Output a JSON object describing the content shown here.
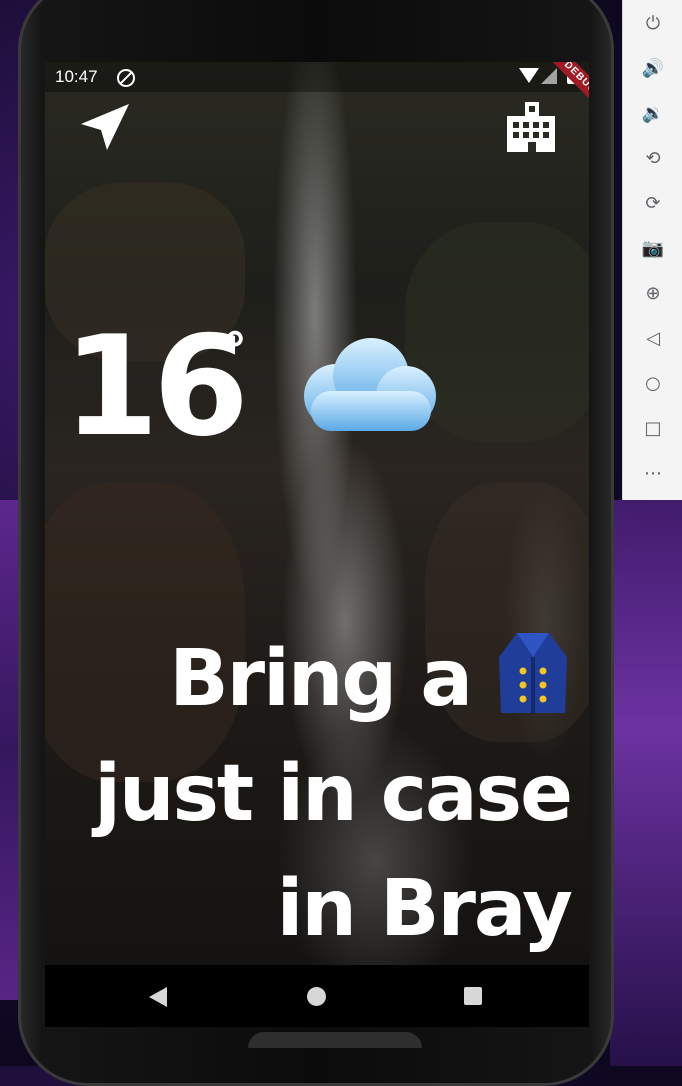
{
  "status_bar": {
    "time": "10:47",
    "debug_label": "DEBUG"
  },
  "weather": {
    "temperature": "16",
    "degree_symbol": "°",
    "condition_icon": "cloud-icon"
  },
  "message": {
    "line1": "Bring a",
    "line2": "just in case",
    "line3": "in Bray",
    "item_icon": "coat-icon"
  },
  "header_icons": {
    "left": "navigation-arrow-icon",
    "right": "city-icon"
  },
  "nav_bar": {
    "back": "back-icon",
    "home": "home-icon",
    "recents": "recents-icon"
  },
  "emulator_toolbar": [
    {
      "name": "power-icon",
      "glyph": "⏻"
    },
    {
      "name": "volume-up-icon",
      "glyph": "🔊"
    },
    {
      "name": "volume-down-icon",
      "glyph": "🔉"
    },
    {
      "name": "rotate-left-icon",
      "glyph": "⟲"
    },
    {
      "name": "rotate-right-icon",
      "glyph": "⟳"
    },
    {
      "name": "camera-icon",
      "glyph": "📷"
    },
    {
      "name": "zoom-icon",
      "glyph": "⊕"
    },
    {
      "name": "back-icon",
      "glyph": "◁"
    },
    {
      "name": "home-icon",
      "glyph": "○"
    },
    {
      "name": "overview-icon",
      "glyph": "□"
    },
    {
      "name": "more-icon",
      "glyph": "⋯"
    }
  ],
  "colors": {
    "text": "#ffffff",
    "debug_ribbon": "#a01a26",
    "cloud_light": "#b7e0fb",
    "cloud_dark": "#5aa9e6",
    "coat": "#1f3d99",
    "buttons": "#f3c623"
  }
}
